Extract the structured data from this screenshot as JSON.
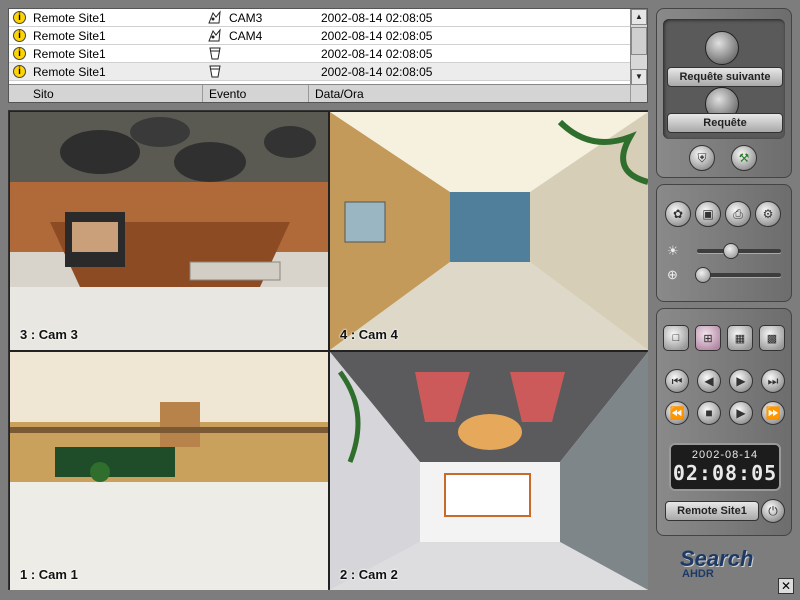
{
  "events": {
    "columns": {
      "site": "Sito",
      "event": "Evento",
      "date": "Data/Ora"
    },
    "rows": [
      {
        "site": "Remote Site1",
        "event": "CAM3",
        "date": "2002-08-14 02:08:05",
        "icon": "motion-icon"
      },
      {
        "site": "Remote Site1",
        "event": "CAM4",
        "date": "2002-08-14 02:08:05",
        "icon": "motion-icon"
      },
      {
        "site": "Remote Site1",
        "event": "",
        "date": "2002-08-14 02:08:05",
        "icon": "sensor-icon"
      },
      {
        "site": "Remote Site1",
        "event": "",
        "date": "2002-08-14 02:08:05",
        "icon": "sensor-icon"
      }
    ],
    "warn_glyph": "i"
  },
  "cameras": {
    "top_left": "3 : Cam 3",
    "top_right": "4 : Cam 4",
    "bottom_left": "1 : Cam 1",
    "bottom_right": "2 : Cam 2"
  },
  "search_panel": {
    "next_label": "Requête suivante",
    "query_label": "Requête"
  },
  "clock": {
    "date": "2002-08-14",
    "time": "02:08:05"
  },
  "site_select": {
    "value": "Remote Site1"
  },
  "brand": {
    "title": "Search",
    "sub": "AHDR"
  },
  "colors": {
    "panel": "#7a7a7a",
    "accent": "#1d3a66",
    "warn": "#ffd400"
  }
}
